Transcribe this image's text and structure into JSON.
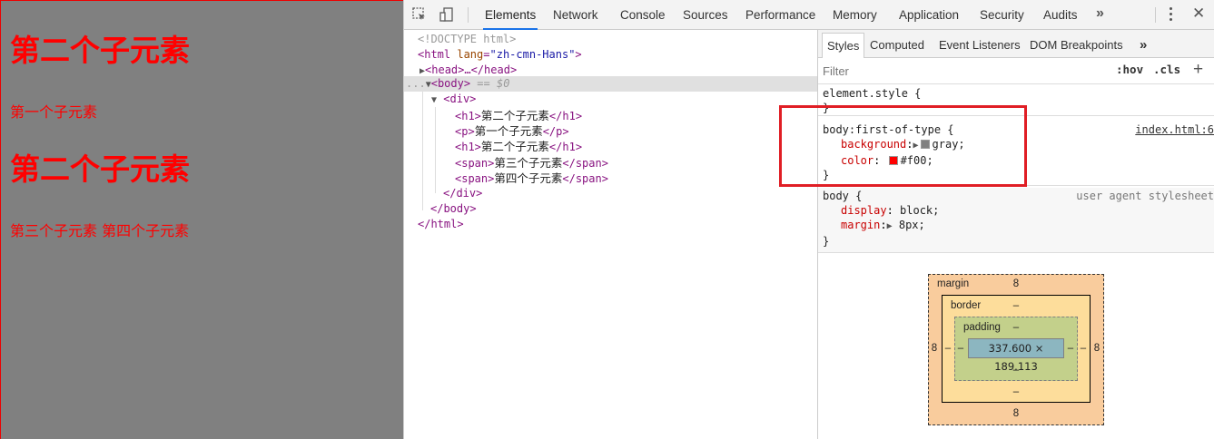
{
  "page": {
    "h1_first": "第二个子元素",
    "p_first": "第一个子元素",
    "h1_second": "第二个子元素",
    "spans_line": "第三个子元素 第四个子元素"
  },
  "devtools": {
    "tabs": [
      "Elements",
      "Network",
      "Console",
      "Sources",
      "Performance",
      "Memory",
      "Application",
      "Security",
      "Audits"
    ],
    "more": "»",
    "close": "✕"
  },
  "dom": {
    "doctype": "<!DOCTYPE html>",
    "html_open_tag": "<html",
    "html_attr": "lang",
    "html_attr_eq": "=",
    "html_attr_val": "\"zh-cmn-Hans\"",
    "html_close_angle": ">",
    "head": "<head>…</head>",
    "ellipsis": "...",
    "body_open": "<body>",
    "body_eq": " == $0",
    "div_open": "<div>",
    "h1_open": "<h1>",
    "h1_close": "</h1>",
    "h1_text": "第二个子元素",
    "p_open": "<p>",
    "p_close": "</p>",
    "p_text": "第一个子元素",
    "h1b_text": "第二个子元素",
    "span_open": "<span>",
    "span_close": "</span>",
    "span1_text": "第三个子元素",
    "span2_text": "第四个子元素",
    "div_close": "</div>",
    "body_close": "</body>",
    "html_close": "</html>"
  },
  "styles": {
    "subtabs": [
      "Styles",
      "Computed",
      "Event Listeners",
      "DOM Breakpoints"
    ],
    "subtabs_more": "»",
    "filter_placeholder": "Filter",
    "hov": ":hov",
    "cls": ".cls",
    "plus": "+",
    "element_style": "element.style {",
    "brace_close": "}",
    "rule1_selector": "body:first-of-type {",
    "rule1_source": "index.html:6",
    "rule1_prop1": "background",
    "rule1_val1": "gray;",
    "rule1_prop2": "color",
    "rule1_val2": "#f00;",
    "rule2_selector": "body {",
    "rule2_source": "user agent stylesheet",
    "rule2_prop1": "display",
    "rule2_val1": "block;",
    "rule2_prop2": "margin",
    "rule2_val2": "8px;"
  },
  "boxmodel": {
    "margin_label": "margin",
    "border_label": "border",
    "padding_label": "padding",
    "margin_top": "8",
    "margin_bottom": "8",
    "margin_left": "8",
    "margin_right": "8",
    "border_top": "–",
    "border_bottom": "–",
    "border_left": "–",
    "border_right": "–",
    "padding_top": "–",
    "padding_bottom": "–",
    "padding_left": "–",
    "padding_right": "–",
    "content": "337.600 × 189.113"
  },
  "colors": {
    "page_bg": "#808080",
    "page_text": "#ff0000",
    "highlight_box": "#e01e25",
    "active_tab": "#1a73e8"
  }
}
